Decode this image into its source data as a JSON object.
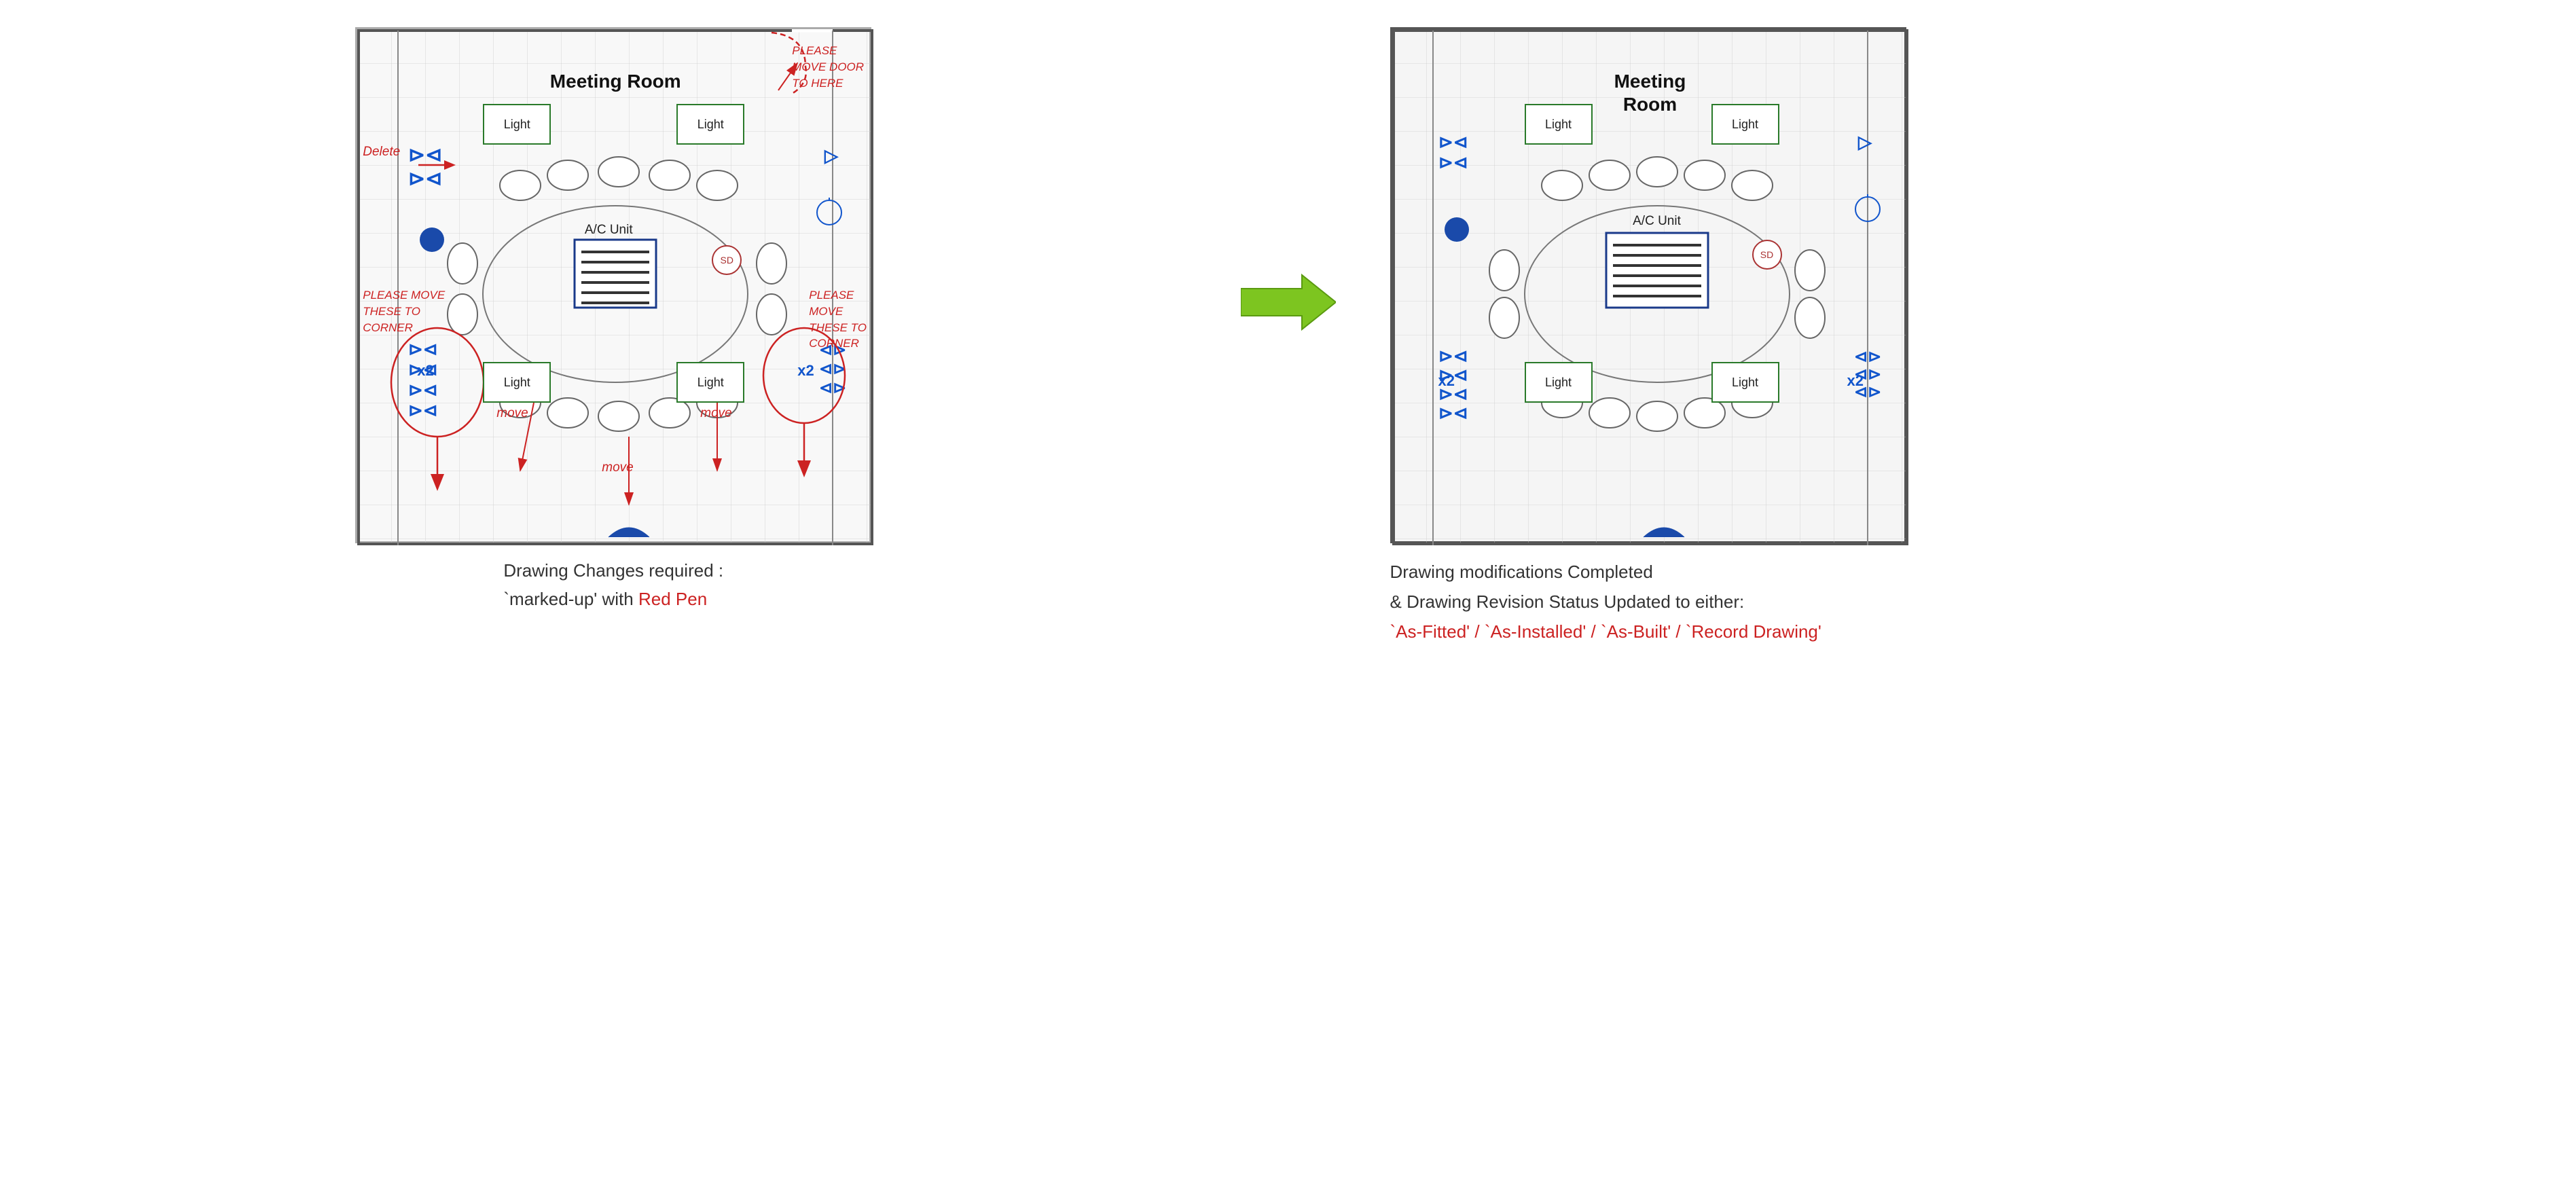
{
  "left": {
    "caption_line1": "Drawing  Changes required :",
    "caption_line2_before": "`marked-up' with ",
    "caption_red": "Red Pen"
  },
  "right": {
    "caption_line1": "Drawing modifications Completed",
    "caption_line2": "& Drawing Revision Status Updated to either:",
    "caption_red": "`As-Fitted' /  `As-Installed' /  `As-Built' /  `Record Drawing'"
  },
  "room_title": "Meeting\nRoom",
  "lights": {
    "label": "Light"
  },
  "ac": {
    "label": "A/C Unit"
  },
  "sd_label": "SD",
  "x2_label": "x2",
  "annotations": {
    "delete": "Delete",
    "please_move_door": "PLEASE MOVE DOOR\nTO HERE",
    "please_move_these": "PLEASE MOVE\nTHESE TO CORNER",
    "please_move_corner": "PLEASE MOVE\nTHESE TO\nCORNER",
    "move1": "move",
    "move2": "move",
    "move3": "move"
  }
}
